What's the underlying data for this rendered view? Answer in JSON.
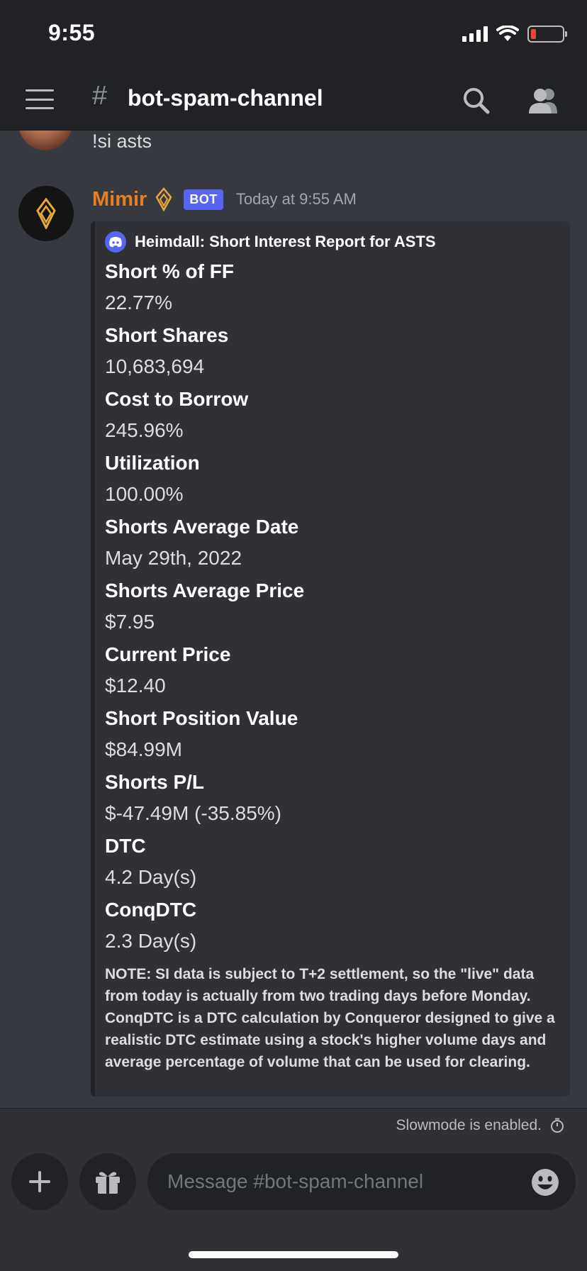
{
  "status_bar": {
    "time": "9:55"
  },
  "header": {
    "channel_name": "bot-spam-channel"
  },
  "previous_message": {
    "text": "!si asts"
  },
  "bot_message": {
    "author": "Mimir",
    "bot_tag": "BOT",
    "timestamp": "Today at 9:55 AM",
    "embed": {
      "author": "Heimdall: Short Interest Report for ASTS",
      "fields": [
        {
          "name": "Short % of FF",
          "value": "22.77%"
        },
        {
          "name": "Short Shares",
          "value": "10,683,694"
        },
        {
          "name": "Cost to Borrow",
          "value": "245.96%"
        },
        {
          "name": "Utilization",
          "value": "100.00%"
        },
        {
          "name": "Shorts Average Date",
          "value": "May 29th, 2022"
        },
        {
          "name": "Shorts Average Price",
          "value": "$7.95"
        },
        {
          "name": "Current Price",
          "value": "$12.40"
        },
        {
          "name": "Short Position Value",
          "value": "$84.99M"
        },
        {
          "name": "Shorts P/L",
          "value": "$-47.49M (-35.85%)"
        },
        {
          "name": "DTC",
          "value": "4.2 Day(s)"
        },
        {
          "name": "ConqDTC",
          "value": "2.3 Day(s)"
        }
      ],
      "footer": "NOTE: SI data is subject to T+2 settlement, so the \"live\" data from today is actually from two trading days before Monday. ConqDTC is a DTC calculation by Conqueror designed to give a realistic DTC estimate using a stock's higher volume days and average percentage of volume that can be used for clearing."
    }
  },
  "composer": {
    "slowmode_text": "Slowmode is enabled.",
    "placeholder": "Message #bot-spam-channel"
  },
  "colors": {
    "background": "#36393f",
    "header": "#202225",
    "embed": "#2f3136",
    "bot_tag": "#5865f2",
    "author_name": "#e67e22"
  },
  "icons": [
    "menu-icon",
    "hash-icon",
    "search-icon",
    "members-icon",
    "add-icon",
    "gift-icon",
    "emoji-icon",
    "timer-icon",
    "discord-logo-icon",
    "mimir-emblem-icon"
  ]
}
